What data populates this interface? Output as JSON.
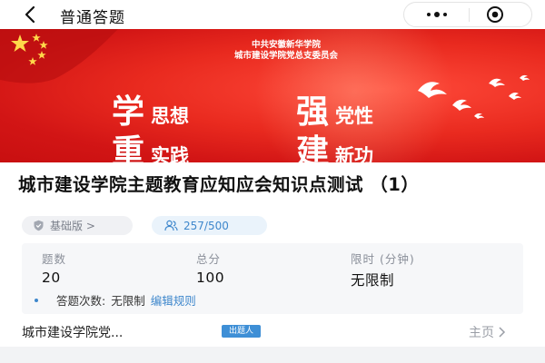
{
  "navbar": {
    "title": "普通答题",
    "back_icon": "chevron-left-icon",
    "more_icon": "more-dots-icon",
    "close_icon": "target-circle-icon"
  },
  "banner": {
    "org_line1": "中共安徽新华学院",
    "org_line2": "城市建设学院党总支委员会",
    "slogans": [
      {
        "big": "学",
        "small": "思想"
      },
      {
        "big": "强",
        "small": "党性"
      },
      {
        "big": "重",
        "small": "实践"
      },
      {
        "big": "建",
        "small": "新功"
      }
    ],
    "colors": {
      "red": "#d21515",
      "text": "#ffffff",
      "star": "#ffd84a"
    }
  },
  "quiz": {
    "title": "城市建设学院主题教育应知应会知识点测试 （1）",
    "edition_badge": "基础版 >",
    "participants_badge": "257/500"
  },
  "stats": {
    "question_count_label": "题数",
    "question_count": "20",
    "total_score_label": "总分",
    "total_score": "100",
    "time_limit_label": "限时 (分钟)",
    "time_limit": "无限制",
    "attempts_label": "答题次数:",
    "attempts_value": "无限制",
    "edit_rules_link": "编辑规则"
  },
  "author": {
    "name": "城市建设学院党...",
    "tag": "出题人",
    "homepage_link": "主页"
  },
  "accent_color": "#3e87cc"
}
